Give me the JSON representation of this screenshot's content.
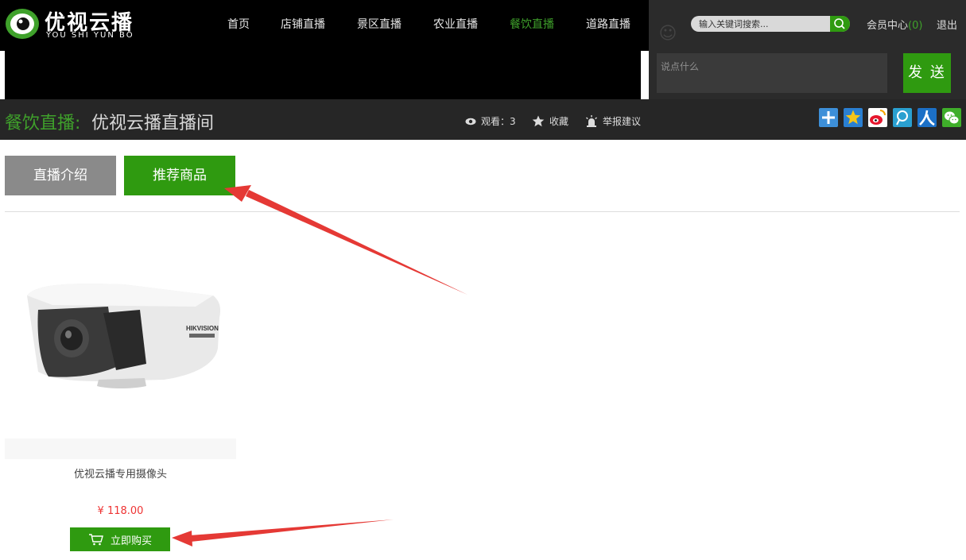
{
  "logo": {
    "title": "优视云播",
    "subtitle": "YOU SHI YUN BO"
  },
  "nav": [
    {
      "label": "首页",
      "active": false
    },
    {
      "label": "店铺直播",
      "active": false
    },
    {
      "label": "景区直播",
      "active": false
    },
    {
      "label": "农业直播",
      "active": false
    },
    {
      "label": "餐饮直播",
      "active": true
    },
    {
      "label": "道路直播",
      "active": false
    }
  ],
  "search": {
    "placeholder": "输入关键词搜索..."
  },
  "member": {
    "label": "会员中心",
    "count": "(0)"
  },
  "logout": "退出",
  "chat": {
    "placeholder": "说点什么",
    "send": "发 送"
  },
  "titlebar": {
    "category": "餐饮直播:",
    "room": "优视云播直播间",
    "views": "观看：3",
    "favorite": "收藏",
    "report": "举报建议"
  },
  "share_icons": [
    "plus-share-icon",
    "qzone-star-icon",
    "weibo-icon",
    "tencent-weibo-icon",
    "renren-icon",
    "wechat-icon"
  ],
  "tabs": {
    "intro": "直播介绍",
    "goods": "推荐商品"
  },
  "product": {
    "name": "优视云播专用摄像头",
    "price": "¥ 118.00",
    "buy": "立即购买",
    "brand_mark": "HIKVISION"
  },
  "colors": {
    "brand_green": "#2f9a10",
    "accent_green": "#3fa12b",
    "price_red": "#e33",
    "annotation_red": "#e53935"
  }
}
